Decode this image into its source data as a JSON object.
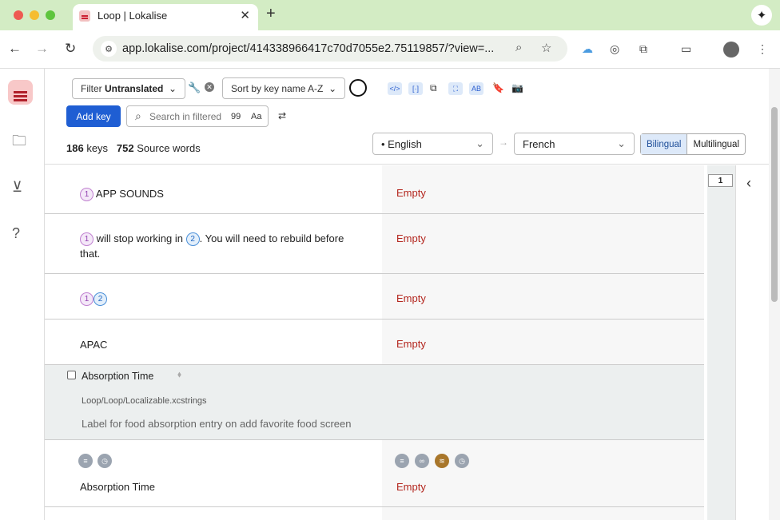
{
  "browser": {
    "tab_title": "Loop | Lokalise",
    "url": "app.lokalise.com/project/414338966417c70d7055e2.75119857/?view=...",
    "tab_close": "✕",
    "new_tab": "+"
  },
  "toolbar": {
    "filter_label": "Filter",
    "filter_value": "Untranslated",
    "sort_label": "Sort by key name A-Z",
    "add_key": "Add key",
    "search_placeholder": "Search in filtered",
    "search_count": "99",
    "case_label": "Aa",
    "keys_count": "186",
    "keys_label": "keys",
    "words_count": "752",
    "words_label": "Source words",
    "source_lang": "• English",
    "target_lang": "French",
    "bilingual": "Bilingual",
    "multilingual": "Multilingual",
    "arrow": "→"
  },
  "rows": [
    {
      "source": "APP SOUNDS",
      "target": "Empty"
    },
    {
      "source_a": "will stop working in",
      "source_b": ". You will need to rebuild before",
      "source_c": "that.",
      "target": "Empty"
    },
    {
      "target": "Empty"
    },
    {
      "source": "APAC",
      "target": "Empty"
    }
  ],
  "key": {
    "name": "Absorption Time",
    "file": "Loop/Loop/Localizable.xcstrings",
    "description": "Label for food absorption entry on add favorite food screen",
    "source": "Absorption Time",
    "target": "Empty"
  },
  "placeholders": {
    "one": "1",
    "two": "2"
  },
  "minimap": {
    "page": "1"
  },
  "icons": {
    "collapse": "‹"
  }
}
